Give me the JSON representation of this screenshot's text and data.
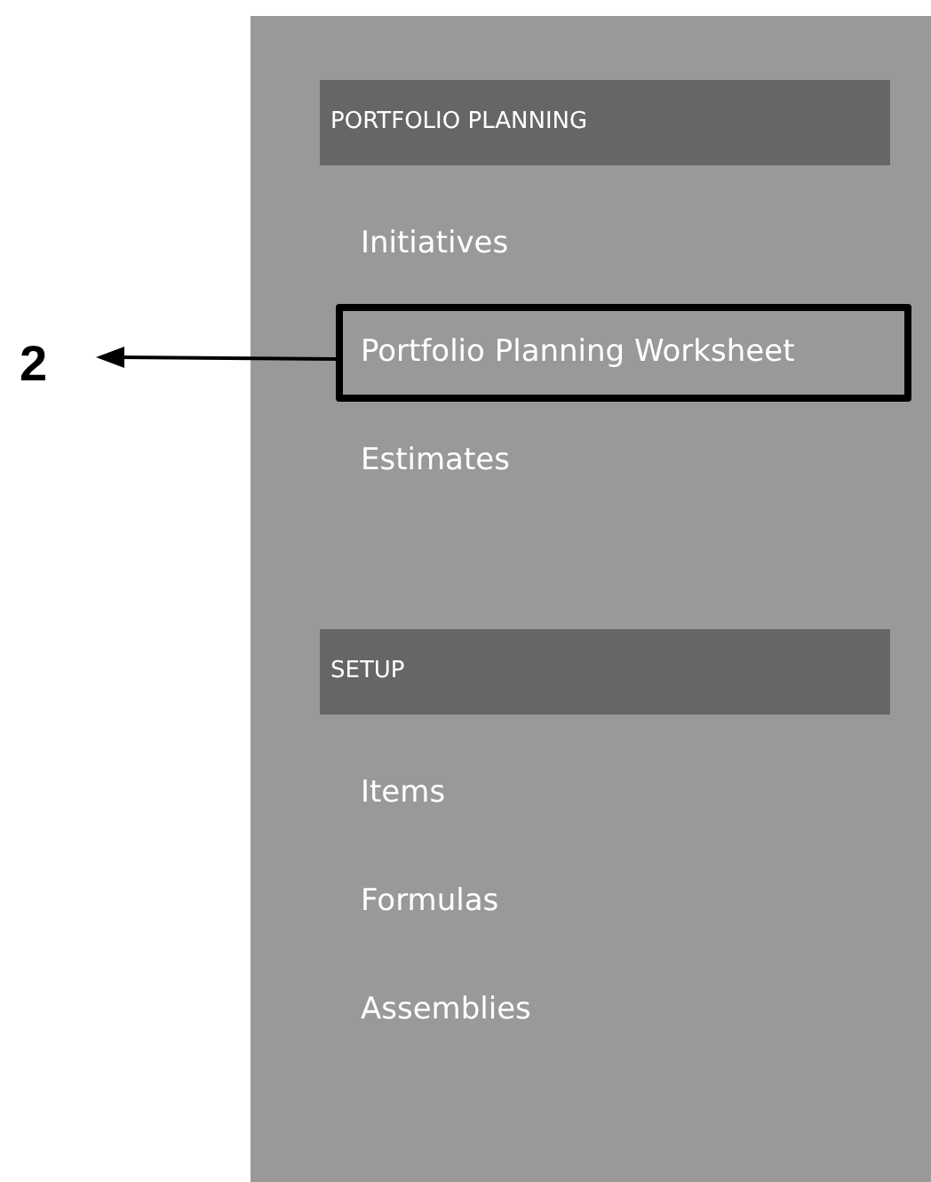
{
  "callout": {
    "label": "2"
  },
  "sections": [
    {
      "title": "PORTFOLIO PLANNING",
      "items": [
        {
          "label": "Initiatives",
          "highlighted": false
        },
        {
          "label": "Portfolio Planning Worksheet",
          "highlighted": true
        },
        {
          "label": "Estimates",
          "highlighted": false
        }
      ]
    },
    {
      "title": "SETUP",
      "items": [
        {
          "label": "Items",
          "highlighted": false
        },
        {
          "label": "Formulas",
          "highlighted": false
        },
        {
          "label": "Assemblies",
          "highlighted": false
        }
      ]
    }
  ]
}
